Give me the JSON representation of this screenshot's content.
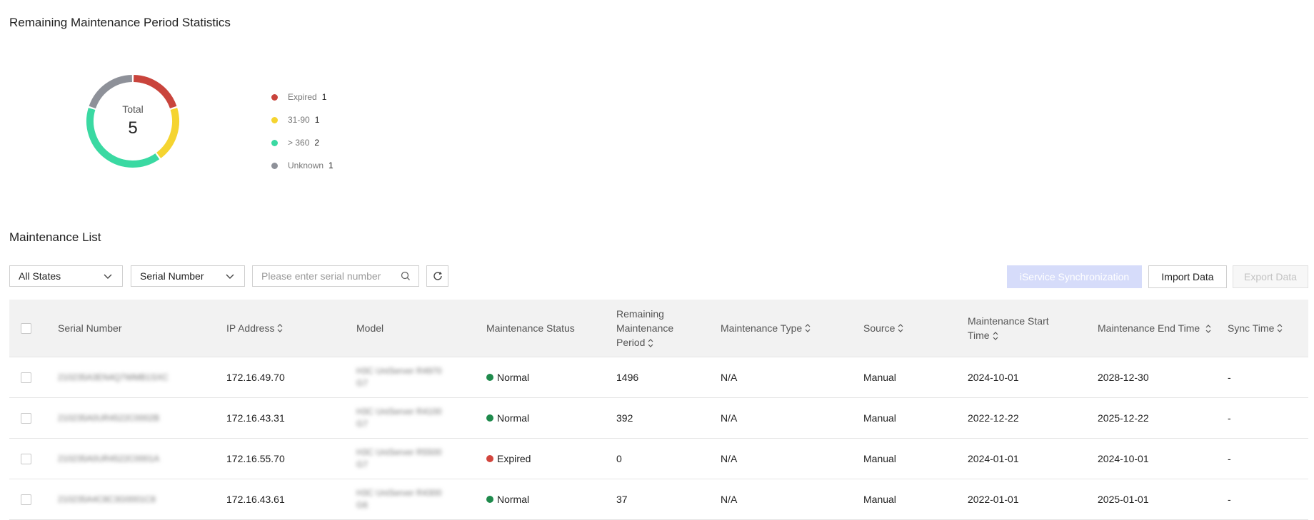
{
  "stats": {
    "title": "Remaining Maintenance Period Statistics",
    "total_label": "Total",
    "total_value": "5"
  },
  "chart_data": {
    "type": "pie",
    "categories": [
      "Expired",
      "31-90",
      "> 360",
      "Unknown"
    ],
    "values": [
      1,
      1,
      2,
      1
    ],
    "colors": [
      "#c9443c",
      "#f5d430",
      "#3ad9a2",
      "#8e9199"
    ],
    "legend_placement": "right"
  },
  "legend": [
    {
      "label": "Expired",
      "count": "1",
      "color": "#c9443c"
    },
    {
      "label": "31-90",
      "count": "1",
      "color": "#f5d430"
    },
    {
      "label": "> 360",
      "count": "2",
      "color": "#3ad9a2"
    },
    {
      "label": "Unknown",
      "count": "1",
      "color": "#8e9199"
    }
  ],
  "list": {
    "title": "Maintenance List",
    "state_select": "All States",
    "field_select": "Serial Number",
    "search_placeholder": "Please enter serial number",
    "sync_button": "iService Synchronization",
    "import_button": "Import Data",
    "export_button": "Export Data"
  },
  "columns": [
    {
      "label": "Serial Number",
      "sortable": false
    },
    {
      "label": "IP Address",
      "sortable": true
    },
    {
      "label": "Model",
      "sortable": false
    },
    {
      "label": "Maintenance Status",
      "sortable": false
    },
    {
      "label": "Remaining Maintenance Period",
      "sortable": true
    },
    {
      "label": "Maintenance Type",
      "sortable": true
    },
    {
      "label": "Source",
      "sortable": true
    },
    {
      "label": "Maintenance Start Time",
      "sortable": true
    },
    {
      "label": "Maintenance End Time",
      "sortable": true
    },
    {
      "label": "Sync Time",
      "sortable": true
    }
  ],
  "status_colors": {
    "Normal": "#1f8a4c",
    "Expired": "#d2453d"
  },
  "rows": [
    {
      "serial": "210235A3EN4Q7WMB1SXC",
      "ip": "172.16.49.70",
      "model": [
        "H3C UniServer R4970",
        "G7"
      ],
      "status": "Normal",
      "remaining": "1496",
      "type": "N/A",
      "source": "Manual",
      "start": "2024-10-01",
      "end": "2028-12-30",
      "sync": "-"
    },
    {
      "serial": "210235A0UR4522C0002B",
      "ip": "172.16.43.31",
      "model": [
        "H3C UniServer R4100",
        "G7"
      ],
      "status": "Normal",
      "remaining": "392",
      "type": "N/A",
      "source": "Manual",
      "start": "2022-12-22",
      "end": "2025-12-22",
      "sync": "-"
    },
    {
      "serial": "210235A0UR4522C0001A",
      "ip": "172.16.55.70",
      "model": [
        "H3C UniServer R5500",
        "G7"
      ],
      "status": "Expired",
      "remaining": "0",
      "type": "N/A",
      "source": "Manual",
      "start": "2024-01-01",
      "end": "2024-10-01",
      "sync": "-"
    },
    {
      "serial": "210235A4C8C3G0001C8",
      "ip": "172.16.43.61",
      "model": [
        "H3C UniServer R4300",
        "G6"
      ],
      "status": "Normal",
      "remaining": "37",
      "type": "N/A",
      "source": "Manual",
      "start": "2022-01-01",
      "end": "2025-01-01",
      "sync": "-"
    }
  ]
}
